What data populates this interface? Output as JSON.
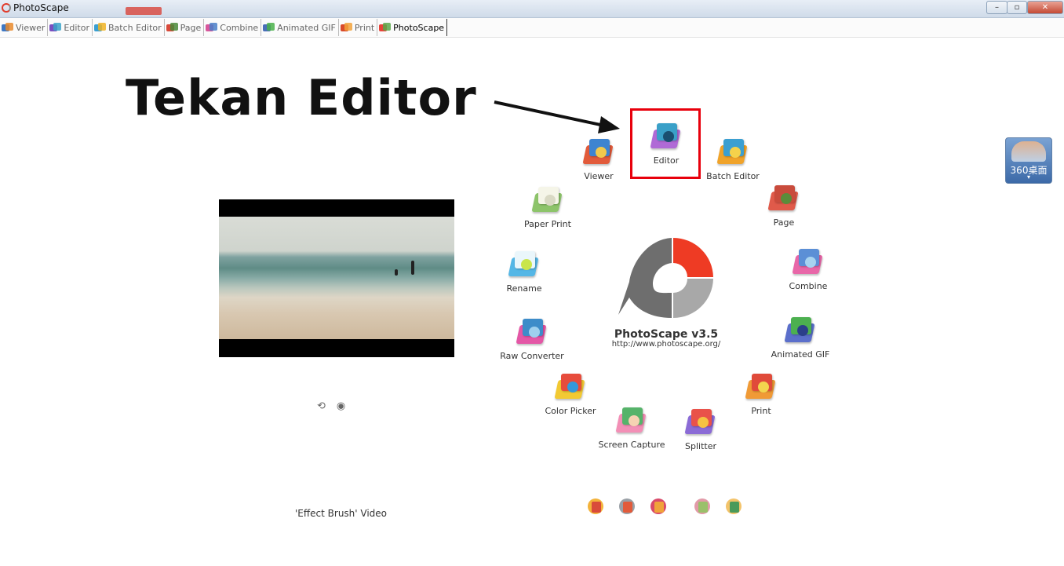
{
  "window": {
    "title": "PhotoScape",
    "controls": {
      "minimize": "–",
      "maximize": "▫",
      "close": "✕"
    }
  },
  "tabs": [
    {
      "label": "Viewer",
      "icon": "viewer-icon",
      "colors": [
        "#3e78c4",
        "#e98a2c"
      ]
    },
    {
      "label": "Editor",
      "icon": "editor-icon",
      "colors": [
        "#7a4fc0",
        "#3aa3c8"
      ]
    },
    {
      "label": "Batch Editor",
      "icon": "batch-editor-icon",
      "colors": [
        "#3b9fd1",
        "#f0b323"
      ]
    },
    {
      "label": "Page",
      "icon": "page-icon",
      "colors": [
        "#d84a3a",
        "#4a8a3a"
      ]
    },
    {
      "label": "Combine",
      "icon": "combine-icon",
      "colors": [
        "#d8579c",
        "#4a7fc8"
      ]
    },
    {
      "label": "Animated GIF",
      "icon": "animated-gif-icon",
      "colors": [
        "#4a6fb8",
        "#49b049"
      ]
    },
    {
      "label": "Print",
      "icon": "print-icon",
      "colors": [
        "#d94a2a",
        "#f2a23a"
      ]
    },
    {
      "label": "PhotoScape",
      "icon": "photoscape-icon",
      "colors": [
        "#e8443a",
        "#5aa84a"
      ],
      "active": true
    }
  ],
  "annotation": {
    "text": "Tekan Editor",
    "highlight_color": "#e8000c"
  },
  "video": {
    "caption": "'Effect Brush' Video",
    "controls": [
      {
        "icon": "refresh-icon",
        "glyph": "⟲"
      },
      {
        "icon": "eye-icon",
        "glyph": "◉"
      }
    ]
  },
  "brand": {
    "name": "PhotoScape v3.5",
    "url": "http://www.photoscape.org/"
  },
  "menu": [
    {
      "label": "Editor",
      "icon": "editor-camera-icon",
      "colors": [
        "#b06ad6",
        "#3aa0c8",
        "#1a4f70"
      ]
    },
    {
      "label": "Viewer",
      "icon": "viewer-magnifier-icon",
      "colors": [
        "#e25b3b",
        "#3e84d0",
        "#f2c94c"
      ]
    },
    {
      "label": "Batch Editor",
      "icon": "batch-editor-icon",
      "colors": [
        "#f0a32a",
        "#3b9fd1",
        "#f5d24b"
      ]
    },
    {
      "label": "Paper Print",
      "icon": "paper-print-icon",
      "colors": [
        "#8dc46a",
        "#f5f5e8",
        "#d9d9c4"
      ]
    },
    {
      "label": "Page",
      "icon": "page-layout-icon",
      "colors": [
        "#e05a4a",
        "#c94b3c",
        "#5a8c3a"
      ]
    },
    {
      "label": "Rename",
      "icon": "rename-icon",
      "colors": [
        "#55b7e6",
        "#eaf6fb",
        "#c9e54a"
      ]
    },
    {
      "label": "Combine",
      "icon": "combine-icon",
      "colors": [
        "#e867a8",
        "#5b8fd6",
        "#a7d3f0"
      ]
    },
    {
      "label": "Raw Converter",
      "icon": "raw-converter-icon",
      "colors": [
        "#e457a6",
        "#3d8cc9",
        "#9fd0ee"
      ]
    },
    {
      "label": "Animated GIF",
      "icon": "animated-gif-film-icon",
      "colors": [
        "#5b6fcb",
        "#4cb050",
        "#2b3f8a"
      ]
    },
    {
      "label": "Color Picker",
      "icon": "color-picker-icon",
      "colors": [
        "#f2c933",
        "#e74c3c",
        "#3498db"
      ]
    },
    {
      "label": "Print",
      "icon": "printer-icon",
      "colors": [
        "#f09a36",
        "#e04a3a",
        "#f3d54e"
      ]
    },
    {
      "label": "Screen Capture",
      "icon": "screen-capture-icon",
      "colors": [
        "#f38fb6",
        "#56b36a",
        "#f6d2b3"
      ]
    },
    {
      "label": "Splitter",
      "icon": "splitter-icon",
      "colors": [
        "#8b6bd6",
        "#e9524a",
        "#f5c343"
      ]
    }
  ],
  "bottom_icons": [
    {
      "icon": "help-icon",
      "colors": [
        "#f3b23a",
        "#d94a3a"
      ]
    },
    {
      "icon": "tools-icon",
      "colors": [
        "#9aa0a6",
        "#e25b3b"
      ]
    },
    {
      "icon": "language-icon",
      "colors": [
        "#d94a6a",
        "#f0a33a"
      ]
    },
    {
      "icon": "about-icon",
      "colors": [
        "#e29aa8",
        "#9ac06a"
      ]
    },
    {
      "icon": "image-frame-icon",
      "colors": [
        "#f3c36a",
        "#4a9a5a"
      ]
    }
  ],
  "widget": {
    "label": "360桌面",
    "chevron": "▾"
  },
  "colors": {
    "logo_red": "#ee3b24",
    "logo_dark": "#6e6e6e",
    "logo_light": "#a8a8a8"
  }
}
